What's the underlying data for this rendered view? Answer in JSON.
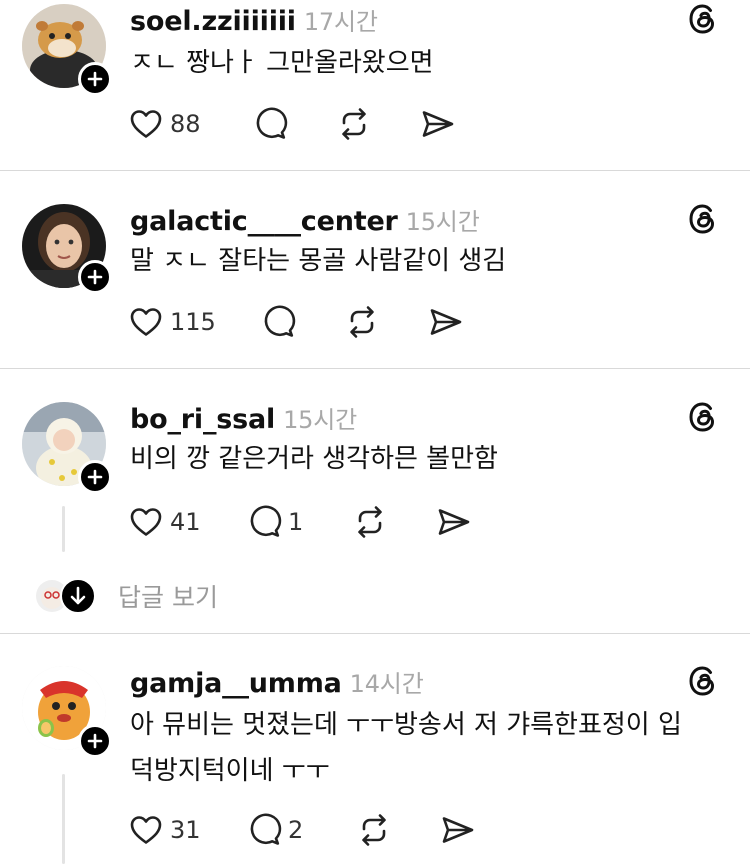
{
  "posts": [
    {
      "username": "soel.zziiiiiii",
      "time": "17시간",
      "text": "ㅈㄴ 짱나ㅏ 그만올라왔으면",
      "likes": "88",
      "replies": ""
    },
    {
      "username": "galactic____center",
      "time": "15시간",
      "text": "말 ㅈㄴ 잘타는 몽골 사람같이 생김",
      "likes": "115",
      "replies": ""
    },
    {
      "username": "bo_ri_ssal",
      "time": "15시간",
      "text": "비의 깡 같은거라 생각하믄 볼만함",
      "likes": "41",
      "replies": "1"
    },
    {
      "username": "gamja__umma",
      "time": "14시간",
      "text_line1": "아 뮤비는 멋졌는데 ㅜㅜ방송서 저 갸륵한표정이 입",
      "text_line2": "덕방지턱이네 ㅜㅜ",
      "likes": "31",
      "replies": "2"
    }
  ],
  "view_replies_label": "답글 보기",
  "icons": [
    "heart-icon",
    "comment-icon",
    "repost-icon",
    "share-icon",
    "threads-logo-icon",
    "follow-plus-icon",
    "down-arrow-icon"
  ]
}
